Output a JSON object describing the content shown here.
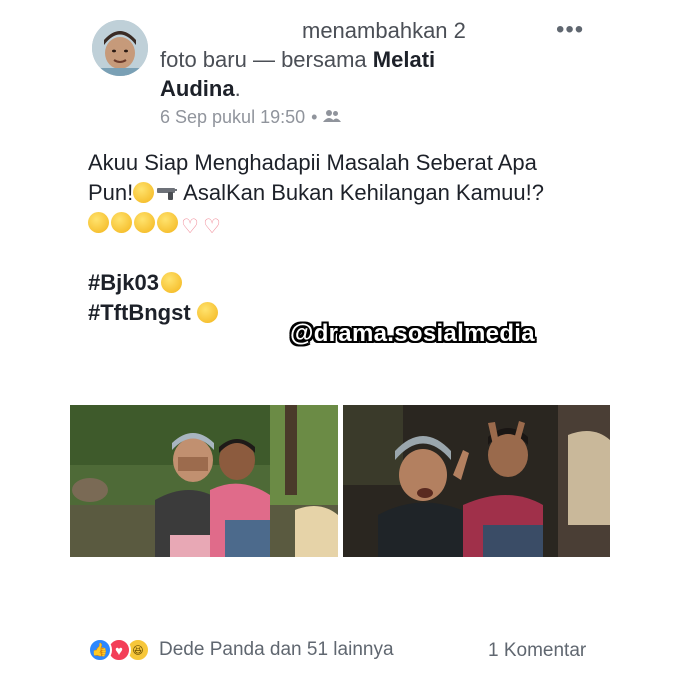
{
  "post": {
    "author_line_1": "menambahkan 2",
    "author_line_2a": "foto baru — bersama ",
    "tagged_name": "Melati Audina",
    "tagged_suffix": ".",
    "timestamp": "6 Sep pukul 19:50",
    "separator": "•",
    "audience_icon": "friends-icon",
    "menu_icon": "more-horizontal-icon",
    "more_label": "•••",
    "body_line_1": "Akuu Siap Menghadapii Masalah Seberat Apa",
    "body_line_2a": "Pun!",
    "body_line_2b": " AsalKan Bukan Kehilangan Kamuu!?",
    "hashtag_1": "#Bjk03",
    "hashtag_2": "#TftBngst",
    "watermark": "@drama.sosialmedia"
  },
  "footer": {
    "reaction_text": "Dede Panda dan 51 lainnya",
    "comment_text": "1 Komentar",
    "like_glyph": "👍",
    "love_glyph": "♥",
    "haha_glyph": "😆"
  },
  "colors": {
    "like": "#2d88ff",
    "love": "#f33e58",
    "haha": "#f7c73a",
    "meta": "#90949c",
    "text": "#1d2129"
  }
}
